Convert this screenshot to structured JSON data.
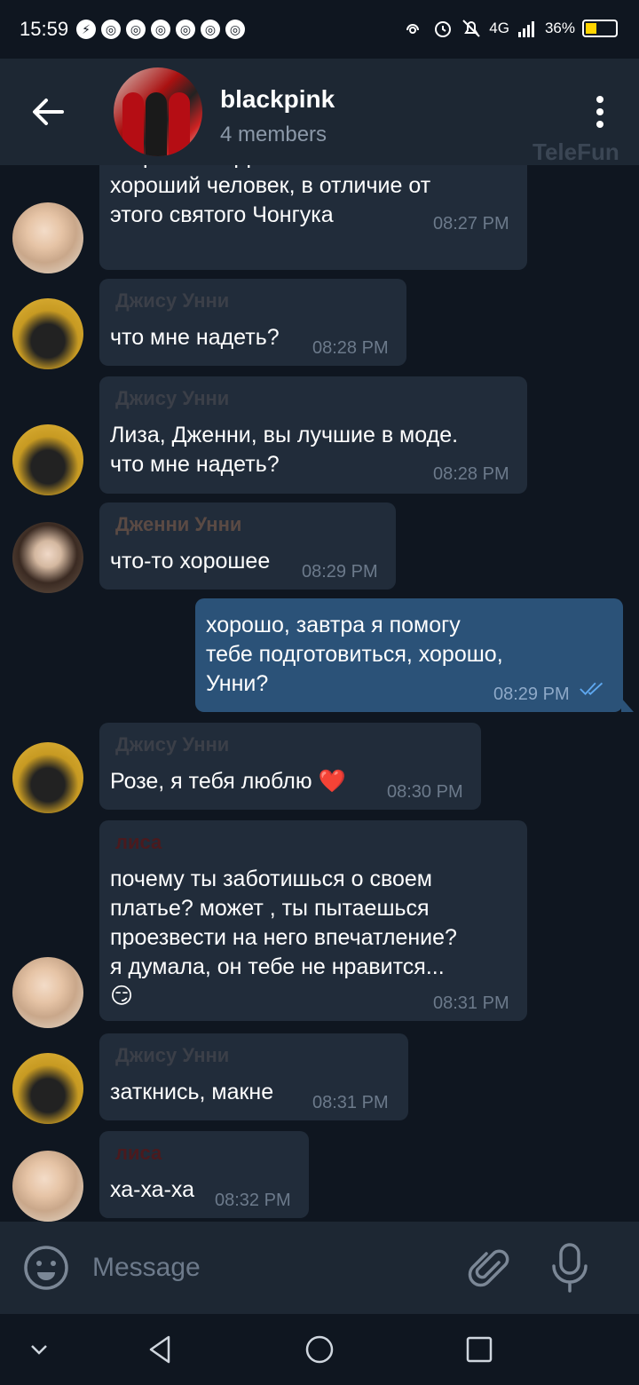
{
  "status_bar": {
    "time": "15:59",
    "battery": "36%",
    "network": "4G",
    "notification_icons": [
      "messenger",
      "chrome",
      "chrome",
      "chrome",
      "chrome",
      "chrome",
      "chrome"
    ]
  },
  "header": {
    "title": "blackpink",
    "subtitle": "4 members",
    "watermark": "TeleFun"
  },
  "messages": [
    {
      "sender": "",
      "text": "встреться с Джин Оппой. он\nхороший человек, в отличие от\nэтого святого Чонгука",
      "time": "08:27 PM",
      "outgoing": false,
      "avatar": "lisa"
    },
    {
      "sender": "Джису Унни",
      "text": "что мне надеть?",
      "time": "08:28 PM",
      "outgoing": false,
      "avatar": "jisoo"
    },
    {
      "sender": "Джису Унни",
      "text": "Лиза, Дженни, вы лучшие в моде.\nчто мне надеть?",
      "time": "08:28 PM",
      "outgoing": false,
      "avatar": "jisoo"
    },
    {
      "sender": "Дженни Унни",
      "text": "что-то хорошее",
      "time": "08:29 PM",
      "outgoing": false,
      "avatar": "jennie"
    },
    {
      "sender": "",
      "text": "хорошо, завтра я помогу\nтебе подготовиться, хорошо,\nУнни?",
      "time": "08:29 PM",
      "outgoing": true,
      "avatar": ""
    },
    {
      "sender": "Джису Унни",
      "text": "Розе, я тебя люблю ❤️",
      "time": "08:30 PM",
      "outgoing": false,
      "avatar": "jisoo"
    },
    {
      "sender": "лиса",
      "text": "почему ты заботишься о своем\nплатье? может , ты пытаешься\nпроезвести на него впечатление?\nя думала, он тебе не нравится...\n😏",
      "time": "08:31 PM",
      "outgoing": false,
      "avatar": "lisa"
    },
    {
      "sender": "Джису Унни",
      "text": "заткнись, макне",
      "time": "08:31 PM",
      "outgoing": false,
      "avatar": "jisoo"
    },
    {
      "sender": "лиса",
      "text": "ха-ха-ха",
      "time": "08:32 PM",
      "outgoing": false,
      "avatar": "lisa"
    }
  ],
  "colors": {
    "jisoo_name": "#3b3f48",
    "jennie_name": "#5a4a44",
    "lisa_name": "#4a1a1e",
    "incoming_bubble": "#212c3a",
    "outgoing_bubble": "#2b5278",
    "read_check": "#5ea8f0"
  },
  "input": {
    "placeholder": "Message"
  }
}
